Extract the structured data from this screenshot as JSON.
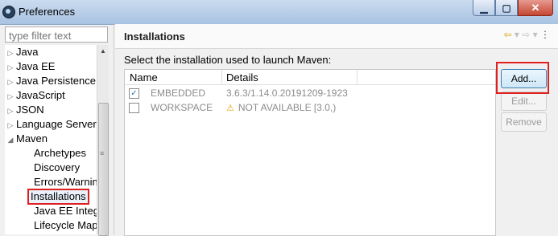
{
  "window": {
    "title": "Preferences"
  },
  "filter": {
    "placeholder": "type filter text"
  },
  "tree": {
    "top_level": [
      "Java",
      "Java EE",
      "Java Persistence",
      "JavaScript",
      "JSON",
      "Language Server"
    ],
    "maven": "Maven",
    "maven_children": [
      "Archetypes",
      "Discovery",
      "Errors/Warnin",
      "Installations",
      "Java EE Integra",
      "Lifecycle Map"
    ],
    "selected": "Installations"
  },
  "page": {
    "title": "Installations",
    "prompt": "Select the installation used to launch Maven:"
  },
  "table": {
    "headers": [
      "Name",
      "Details"
    ],
    "rows": [
      {
        "checked": true,
        "name": "EMBEDDED",
        "details": "3.6.3/1.14.0.20191209-1923",
        "warning": false
      },
      {
        "checked": false,
        "name": "WORKSPACE",
        "details": "NOT AVAILABLE [3.0,)",
        "warning": true
      }
    ]
  },
  "buttons": {
    "add": "Add...",
    "edit": "Edit...",
    "remove": "Remove"
  },
  "icons": {
    "nav_back": "back-arrow-icon",
    "nav_forward": "forward-arrow-icon",
    "warning": "warning-icon"
  },
  "colors": {
    "highlight": "#e02020",
    "warning": "#e2a100"
  }
}
